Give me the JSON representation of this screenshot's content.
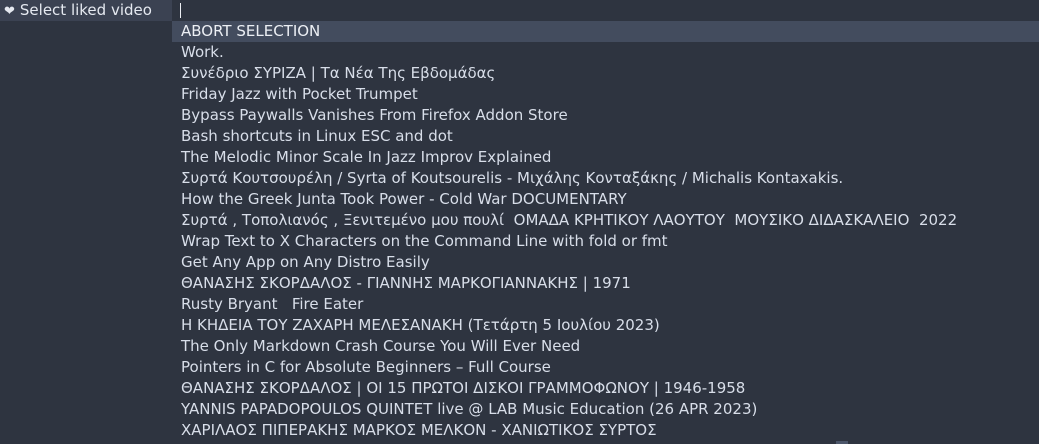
{
  "prompt": {
    "icon": "heart-icon",
    "label": "Select liked video",
    "input_value": ""
  },
  "colors": {
    "background": "#2e3440",
    "prompt_background": "#3b4252",
    "selected_background": "#434c5e",
    "text": "#d8dee9"
  },
  "items": [
    {
      "label": "ABORT SELECTION",
      "selected": true
    },
    {
      "label": "Work.",
      "selected": false
    },
    {
      "label": "Συνέδριο ΣΥΡΙΖΑ | Τα Νέα Της Εβδομάδας",
      "selected": false
    },
    {
      "label": "Friday Jazz with Pocket Trumpet",
      "selected": false
    },
    {
      "label": "Bypass Paywalls Vanishes From Firefox Addon Store",
      "selected": false
    },
    {
      "label": "Bash shortcuts in Linux ESC and dot",
      "selected": false
    },
    {
      "label": "The Melodic Minor Scale In Jazz Improv Explained",
      "selected": false
    },
    {
      "label": "Συρτά Κουτσουρέλη / Syrta of Koutsourelis - Μιχάλης Κονταξάκης / Michalis Kontaxakis.",
      "selected": false
    },
    {
      "label": "How the Greek Junta Took Power - Cold War DOCUMENTARY",
      "selected": false
    },
    {
      "label": "Συρτά , Τοπολιανός , Ξενιτεμένο μου πουλί  ΟΜΑΔΑ ΚΡΗΤΙΚΟΥ ΛΑΟΥΤΟΥ  ΜΟΥΣΙΚΟ ΔΙΔΑΣΚΑΛΕΙΟ  2022",
      "selected": false
    },
    {
      "label": "Wrap Text to X Characters on the Command Line with fold or fmt",
      "selected": false
    },
    {
      "label": "Get Any App on Any Distro Easily",
      "selected": false
    },
    {
      "label": "ΘΑΝΑΣΗΣ ΣΚΟΡΔΑΛΟΣ - ΓΙΑΝΝΗΣ ΜΑΡΚΟΓΙΑΝΝΑΚΗΣ | 1971",
      "selected": false
    },
    {
      "label": "Rusty Bryant   Fire Eater",
      "selected": false
    },
    {
      "label": "Η ΚΗΔΕΙΑ ΤΟΥ ΖΑΧΑΡΗ ΜΕΛΕΣΑΝΑΚΗ (Τετάρτη 5 Ιουλίου 2023)",
      "selected": false
    },
    {
      "label": "The Only Markdown Crash Course You Will Ever Need",
      "selected": false
    },
    {
      "label": "Pointers in C for Absolute Beginners – Full Course",
      "selected": false
    },
    {
      "label": "ΘΑΝΑΣΗΣ ΣΚΟΡΔΑΛΟΣ | ΟΙ 15 ΠΡΩΤΟΙ ΔΙΣΚΟΙ ΓΡΑΜΜΟΦΩΝΟΥ | 1946-1958",
      "selected": false
    },
    {
      "label": "YANNIS PAPADOPOULOS QUINTET live @ LAB Music Education (26 APR 2023)",
      "selected": false
    },
    {
      "label": "ΧΑΡΙΛΑΟΣ ΠΙΠΕΡΑΚΗΣ ΜΑΡΚΟΣ ΜΕΛΚΟΝ - ΧΑΝΙΩΤΙΚΟΣ ΣΥΡΤΟΣ",
      "selected": false
    }
  ]
}
